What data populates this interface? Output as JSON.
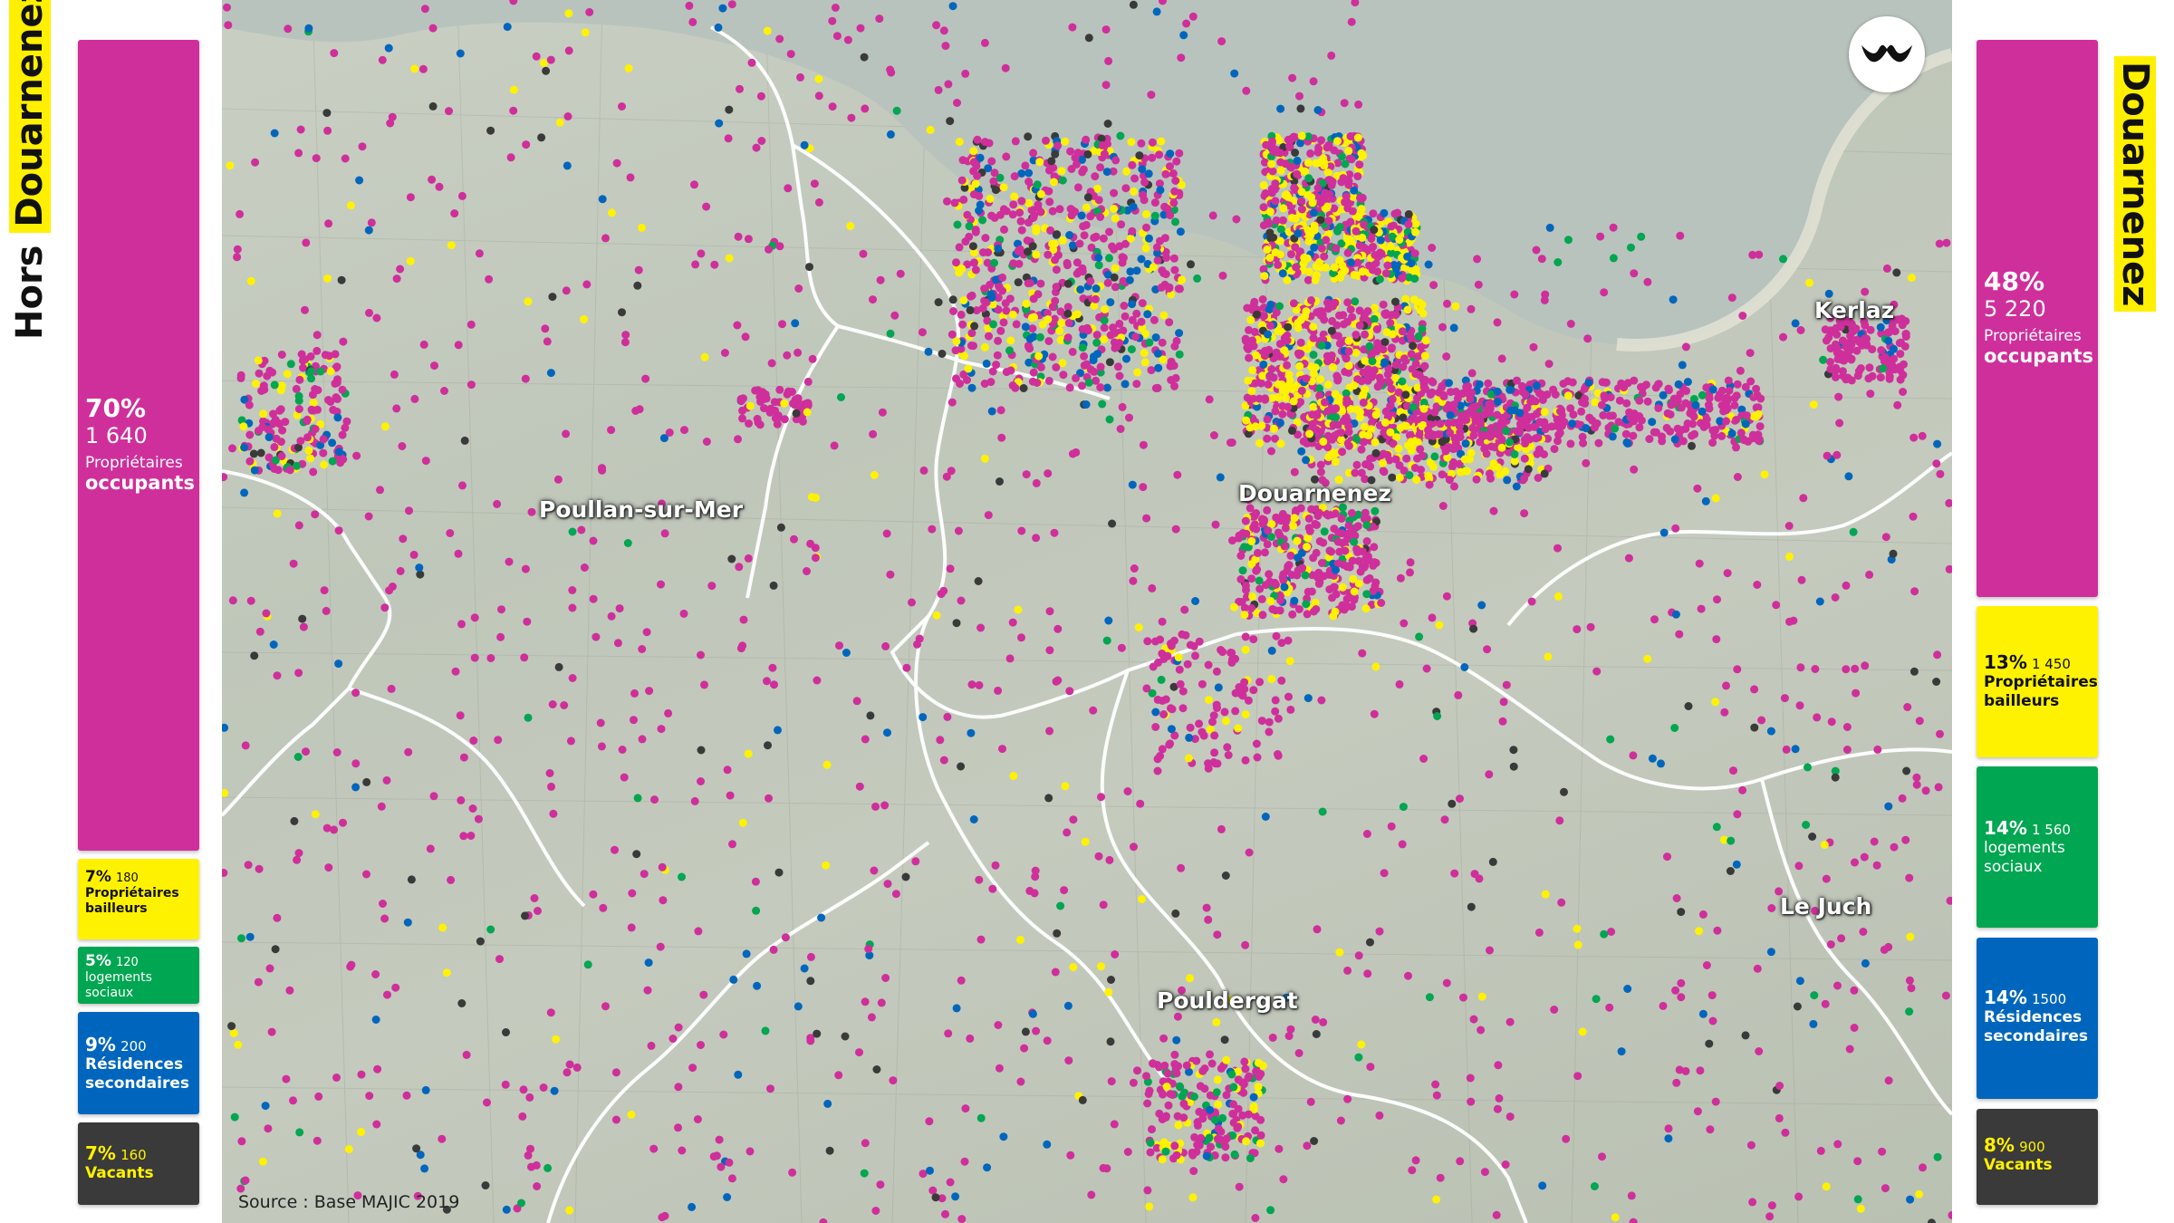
{
  "colors": {
    "occupants": "#cf2f9b",
    "bailleurs": "#fff200",
    "sociaux": "#00a651",
    "secondaires": "#0066bd",
    "vacants": "#3a3a3a"
  },
  "left_panel": {
    "title_plain": "Hors",
    "title_highlight": "Douarnenez",
    "stats": [
      {
        "key": "occupants",
        "pct": "70%",
        "count": "1 640",
        "label_line1": "Propriétaires",
        "label_line2": "occupants",
        "share": 0.7
      },
      {
        "key": "bailleurs",
        "pct": "7%",
        "count": "180",
        "label_line1": "Propriétaires",
        "label_line2": "bailleurs",
        "share": 0.07
      },
      {
        "key": "sociaux",
        "pct": "5%",
        "count": "120",
        "label_line1": "logements",
        "label_line2": "sociaux",
        "share": 0.05
      },
      {
        "key": "secondaires",
        "pct": "9%",
        "count": "200",
        "label_line1": "Résidences",
        "label_line2": "secondaires",
        "share": 0.09
      },
      {
        "key": "vacants",
        "pct": "7%",
        "count": "160",
        "label_line1": "Vacants",
        "label_line2": "",
        "share": 0.07
      }
    ]
  },
  "right_panel": {
    "title_highlight": "Douarnenez",
    "stats": [
      {
        "key": "occupants",
        "pct": "48%",
        "count": "5 220",
        "label_line1": "Propriétaires",
        "label_line2": "occupants",
        "share": 0.48
      },
      {
        "key": "bailleurs",
        "pct": "13%",
        "count": "1 450",
        "label_line1": "Propriétaires",
        "label_line2": "bailleurs",
        "share": 0.13
      },
      {
        "key": "sociaux",
        "pct": "14%",
        "count": "1 560",
        "label_line1": "logements",
        "label_line2": "sociaux",
        "share": 0.14
      },
      {
        "key": "secondaires",
        "pct": "14%",
        "count": "1500",
        "label_line1": "Résidences",
        "label_line2": "secondaires",
        "share": 0.14
      },
      {
        "key": "vacants",
        "pct": "8%",
        "count": "900",
        "label_line1": "Vacants",
        "label_line2": "",
        "share": 0.08
      }
    ]
  },
  "map": {
    "towns": [
      "Douarnenez",
      "Kerlaz",
      "Poullan-sur-Mer",
      "Le Juch",
      "Pouldergat"
    ],
    "source": "Source : Base MAJIC 2019",
    "logo_icon": "studio-logo-icon"
  }
}
